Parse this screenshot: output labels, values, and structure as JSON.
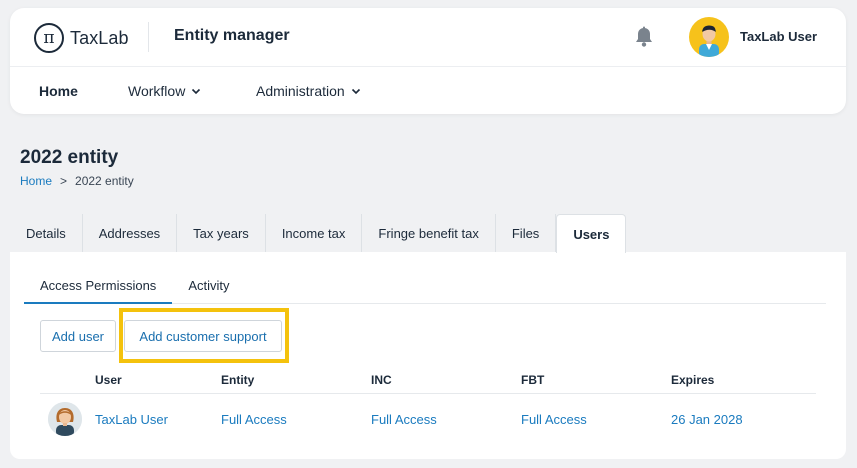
{
  "header": {
    "logo_text": "TaxLab",
    "logo_mark": "π",
    "app_title": "Entity manager",
    "user_name": "TaxLab User"
  },
  "nav": {
    "home": "Home",
    "workflow": "Workflow",
    "administration": "Administration"
  },
  "page": {
    "title": "2022 entity",
    "breadcrumb": {
      "home": "Home",
      "separator": ">",
      "current": "2022 entity"
    }
  },
  "tabs": {
    "details": "Details",
    "addresses": "Addresses",
    "tax_years": "Tax years",
    "income_tax": "Income tax",
    "fringe_benefit_tax": "Fringe benefit tax",
    "files": "Files",
    "users": "Users"
  },
  "subtabs": {
    "access_permissions": "Access Permissions",
    "activity": "Activity"
  },
  "buttons": {
    "add_user": "Add user",
    "add_customer_support": "Add customer support"
  },
  "table": {
    "headers": {
      "user": "User",
      "entity": "Entity",
      "inc": "INC",
      "fbt": "FBT",
      "expires": "Expires"
    },
    "rows": [
      {
        "user": "TaxLab User",
        "entity": "Full Access",
        "inc": "Full Access",
        "fbt": "Full Access",
        "expires": "26 Jan 2028"
      }
    ]
  },
  "colors": {
    "accent": "#1a7bbf",
    "highlight": "#f4c20d",
    "avatar_bg": "#f6c21b"
  },
  "icons": {
    "notifications": "bell-icon",
    "dropdown": "chevron-down-icon"
  }
}
